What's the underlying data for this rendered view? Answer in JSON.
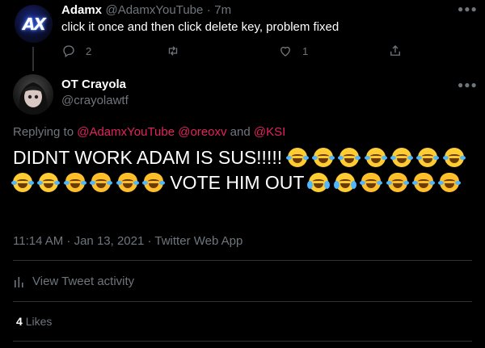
{
  "parent_tweet": {
    "avatar_logo_text": "AX",
    "name": "Adamx",
    "handle": "@AdamxYouTube",
    "separator": "·",
    "time": "7m",
    "text": "click it once and then click delete key, problem fixed",
    "actions": {
      "reply_count": "2",
      "retweet_count": "",
      "like_count": "1"
    }
  },
  "main_tweet": {
    "name": "OT Crayola",
    "handle": "@crayolawtf",
    "replying_to_prefix": "Replying to",
    "replying_to": [
      "@AdamxYouTube",
      "@oreoxv",
      "@KSI"
    ],
    "replying_conjunction": "and",
    "text_part1": "DIDNT WORK ADAM IS SUS!!!!!",
    "text_part2": "VOTE HIM OUT",
    "timestamp": "11:14 AM · Jan 13, 2021 · Twitter Web App",
    "view_activity": "View Tweet activity",
    "likes_count": "4",
    "likes_label": "Likes"
  },
  "colors": {
    "background": "#000000",
    "link": "#e0245e",
    "muted": "#6e767d",
    "divider": "#2f3336"
  },
  "icons": [
    "reply-icon",
    "retweet-icon",
    "like-icon",
    "share-icon",
    "more-icon",
    "activity-icon",
    "emoji-joy",
    "emoji-joy-cat",
    "emoji-loudly-crying"
  ]
}
